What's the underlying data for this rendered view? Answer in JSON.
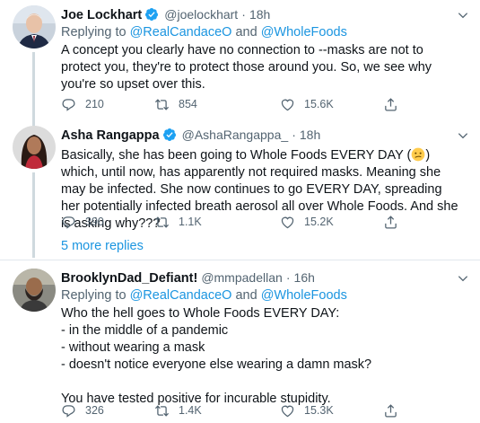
{
  "tweets": [
    {
      "name": "Joe Lockhart",
      "handle": "@joelockhart",
      "dot": "·",
      "time": "18h",
      "verified": true,
      "reply_prefix": "Replying to ",
      "reply_mention_1": "@RealCandaceO",
      "reply_and": " and ",
      "reply_mention_2": "@WholeFoods",
      "text": "A concept you clearly have no connection to --masks are not to protect you, they're to protect those around you. So, we see why you're so upset over this.",
      "replies": "210",
      "retweets": "854",
      "likes": "15.6K"
    },
    {
      "name": "Asha Rangappa",
      "handle": "@AshaRangappa_",
      "dot": "·",
      "time": "18h",
      "verified": true,
      "text_before_emoji": "Basically, she has been going to Whole Foods EVERY DAY (",
      "emoji": "confused-face",
      "text_after_emoji": ") which, until now, has apparently not required masks. Meaning she may be infected. She now continues to go EVERY DAY, spreading her potentially infected breath aerosol all over Whole Foods. And she is asking why???",
      "replies": "390",
      "retweets": "1.1K",
      "likes": "15.2K"
    },
    {
      "name": "BrooklynDad_Defiant!",
      "handle": "@mmpadellan",
      "dot": "·",
      "time": "16h",
      "verified": false,
      "reply_prefix": "Replying to ",
      "reply_mention_1": "@RealCandaceO",
      "reply_and": " and ",
      "reply_mention_2": "@WholeFoods",
      "text": "Who the hell goes to Whole Foods EVERY DAY:\n- in the middle of a pandemic\n- without wearing a mask\n- doesn't notice everyone else wearing a damn mask?\n\nYou have tested positive for incurable stupidity.",
      "replies": "326",
      "retweets": "1.4K",
      "likes": "15.3K"
    }
  ],
  "more_replies": "5 more replies",
  "colors": {
    "link": "#1b95e0",
    "muted": "#536471",
    "verified": "#1da1f2",
    "divider": "#e1e8ed"
  }
}
